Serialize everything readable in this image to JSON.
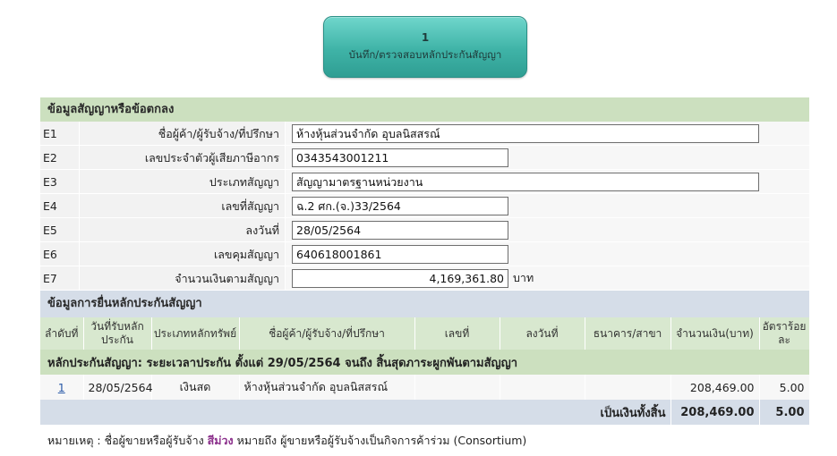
{
  "step_button": {
    "number": "1",
    "label": "บันทึก/ตรวจสอบหลักประกันสัญญา"
  },
  "contract_section": {
    "title": "ข้อมูลสัญญาหรือข้อตกลง",
    "fields": [
      {
        "code": "E1",
        "label": "ชื่อผู้ค้า/ผู้รับจ้าง/ที่ปรึกษา",
        "value": "ห้างหุ้นส่วนจำกัด อุบลนิสสรณ์"
      },
      {
        "code": "E2",
        "label": "เลขประจำตัวผู้เสียภาษีอากร",
        "value": "0343543001211"
      },
      {
        "code": "E3",
        "label": "ประเภทสัญญา",
        "value": "สัญญามาตรฐานหน่วยงาน"
      },
      {
        "code": "E4",
        "label": "เลขที่สัญญา",
        "value": "ฉ.2 ศก.(จ.)33/2564"
      },
      {
        "code": "E5",
        "label": "ลงวันที่",
        "value": "28/05/2564"
      },
      {
        "code": "E6",
        "label": "เลขคุมสัญญา",
        "value": "640618001861"
      },
      {
        "code": "E7",
        "label": "จำนวนเงินตามสัญญา",
        "value": "4,169,361.80",
        "unit": "บาท"
      }
    ]
  },
  "guarantee_section": {
    "title": "ข้อมูลการยื่นหลักประกันสัญญา",
    "columns": [
      "ลำดับที่",
      "วันที่รับหลักประกัน",
      "ประเภทหลักทรัพย์",
      "ชื่อผู้ค้า/ผู้รับจ้าง/ที่ปรึกษา",
      "เลขที่",
      "ลงวันที่",
      "ธนาคาร/สาขา",
      "จำนวนเงิน(บาท)",
      "อัตราร้อยละ"
    ],
    "period_text": "หลักประกันสัญญา: ระยะเวลาประกัน ตั้งแต่ 29/05/2564 จนถึง สิ้นสุดภาระผูกพันตามสัญญา",
    "rows": [
      {
        "no": "1",
        "received_date": "28/05/2564",
        "type": "เงินสด",
        "vendor": "ห้างหุ้นส่วนจำกัด อุบลนิสสรณ์",
        "number": "",
        "date": "",
        "bank": "",
        "amount": "208,469.00",
        "percent": "5.00"
      }
    ],
    "total": {
      "label": "เป็นเงินทั้งสิ้น",
      "amount": "208,469.00",
      "percent": "5.00"
    }
  },
  "note": {
    "prefix": "หมายเหตุ : ชื่อผู้ขายหรือผู้รับจ้าง ",
    "highlight": "สีม่วง",
    "suffix": " หมายถึง ผู้ขายหรือผู้รับจ้างเป็นกิจการค้าร่วม (Consortium)",
    "highlight_color": "#8b2f8b"
  }
}
